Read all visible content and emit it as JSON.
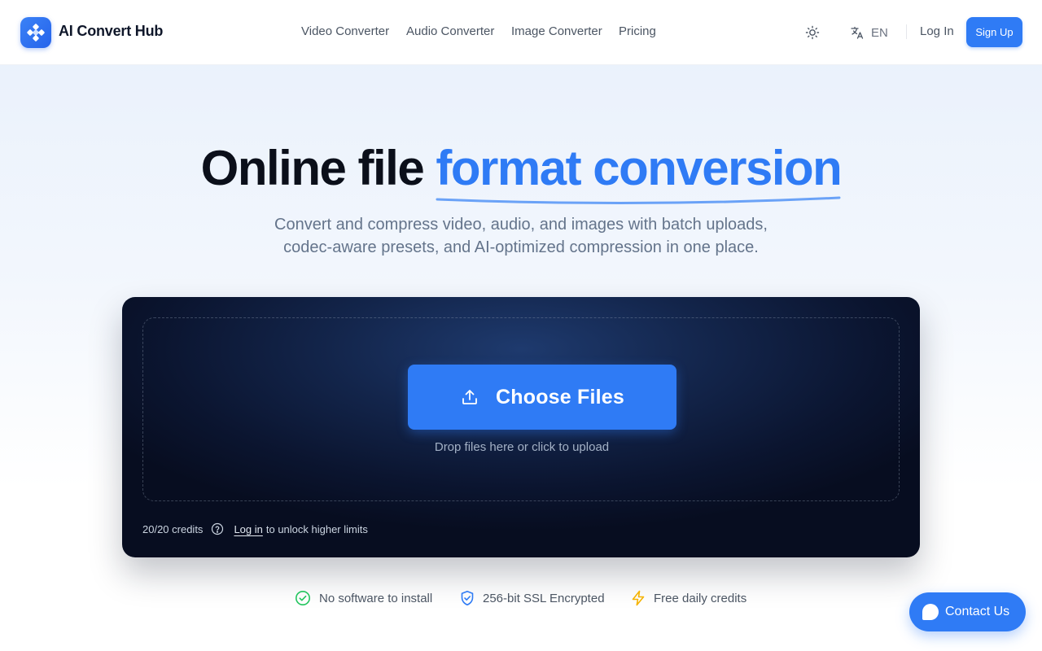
{
  "brand": {
    "name": "AI Convert Hub"
  },
  "nav": {
    "items": [
      "Video Converter",
      "Audio Converter",
      "Image Converter",
      "Pricing"
    ]
  },
  "header": {
    "language": "EN",
    "login_label": "Log In",
    "signup_label": "Sign Up"
  },
  "hero": {
    "title_plain": "Online file ",
    "title_accent": "format conversion",
    "subtitle_line1": "Convert and compress video, audio, and images with batch uploads,",
    "subtitle_line2": "codec-aware presets, and AI-optimized compression in one place."
  },
  "upload": {
    "button_label": "Choose Files",
    "hint": "Drop files here or click to upload",
    "credits": "20/20 credits",
    "login_link": "Log in",
    "unlock_text": "to unlock higher limits"
  },
  "trust": [
    {
      "label": "No software to install",
      "icon": "check-circle-icon"
    },
    {
      "label": "256-bit SSL Encrypted",
      "icon": "shield-check-icon"
    },
    {
      "label": "Free daily credits",
      "icon": "lightning-icon"
    }
  ],
  "contact": {
    "label": "Contact Us"
  },
  "colors": {
    "accent": "#2f7bf5",
    "card_dark": "#0b1530",
    "success": "#22c55e",
    "warning": "#f5b301"
  }
}
